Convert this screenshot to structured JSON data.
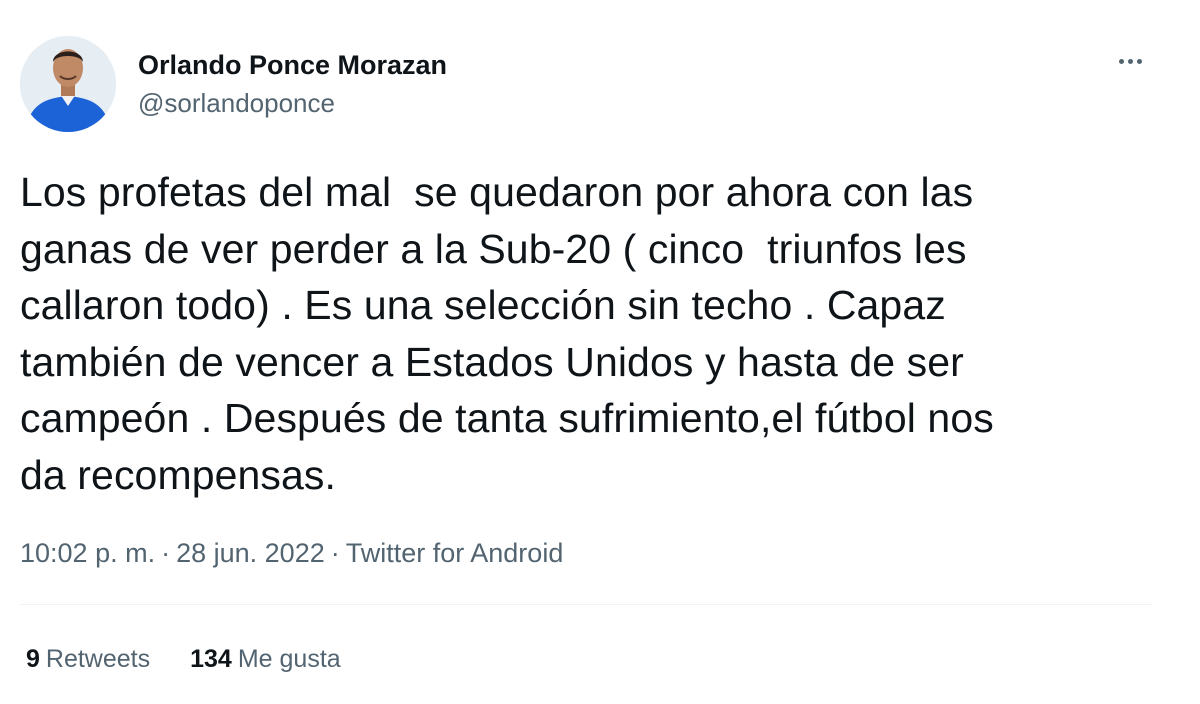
{
  "author": {
    "display_name": "Orlando Ponce Morazan",
    "handle": "@sorlandoponce",
    "avatar_icon": "user-photo-avatar"
  },
  "menu": {
    "icon": "more-horizontal-icon"
  },
  "tweet": {
    "text": "Los profetas del mal  se quedaron por ahora con las\nganas de ver perder a la Sub-20 ( cinco  triunfos les\ncallaron todo) . Es una selección sin techo . Capaz\ntambién de vencer a Estados Unidos y hasta de ser\ncampeón . Después de tanta sufrimiento,el fútbol nos\nda recompensas.",
    "time": "10:02 p. m.",
    "separator": "·",
    "date": "28 jun. 2022",
    "source": "Twitter for Android"
  },
  "stats": {
    "retweets_count": "9",
    "retweets_label": "Retweets",
    "likes_count": "134",
    "likes_label": "Me gusta"
  },
  "colors": {
    "text_primary": "#0f1419",
    "text_secondary": "#536471",
    "divider": "#eff3f4",
    "avatar_shirt": "#1d63d8"
  }
}
